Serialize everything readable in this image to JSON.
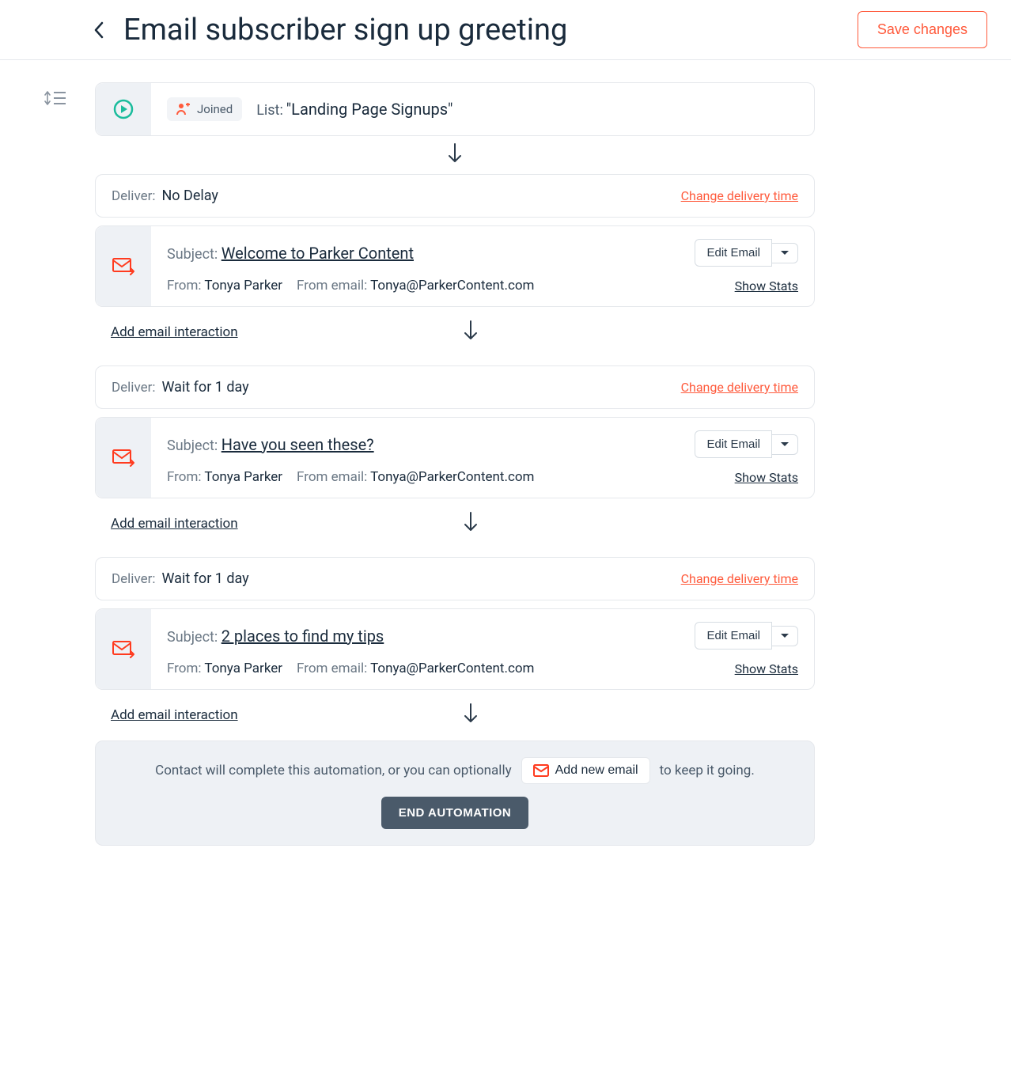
{
  "header": {
    "title": "Email subscriber sign up greeting",
    "save_label": "Save changes"
  },
  "trigger": {
    "joined_label": "Joined",
    "list_label": "List:",
    "list_name": "\"Landing Page Signups\""
  },
  "labels": {
    "deliver": "Deliver:",
    "change_delivery": "Change delivery time",
    "subject": "Subject:",
    "from": "From:",
    "from_email": "From email:",
    "edit_email": "Edit Email",
    "show_stats": "Show Stats",
    "add_interaction": "Add email interaction"
  },
  "emails": [
    {
      "deliver_value": "No Delay",
      "subject": "Welcome to Parker Content",
      "from_name": "Tonya Parker",
      "from_email": "Tonya@ParkerContent.com"
    },
    {
      "deliver_value": "Wait for 1 day",
      "subject": "Have you seen these?",
      "from_name": "Tonya Parker",
      "from_email": "Tonya@ParkerContent.com"
    },
    {
      "deliver_value": "Wait for 1 day",
      "subject": "2 places to find my tips",
      "from_name": "Tonya Parker",
      "from_email": "Tonya@ParkerContent.com"
    }
  ],
  "footer": {
    "text_before": "Contact will complete this automation, or you can optionally",
    "add_email_label": "Add new email",
    "text_after": "to keep it going.",
    "end_label": "END AUTOMATION"
  }
}
